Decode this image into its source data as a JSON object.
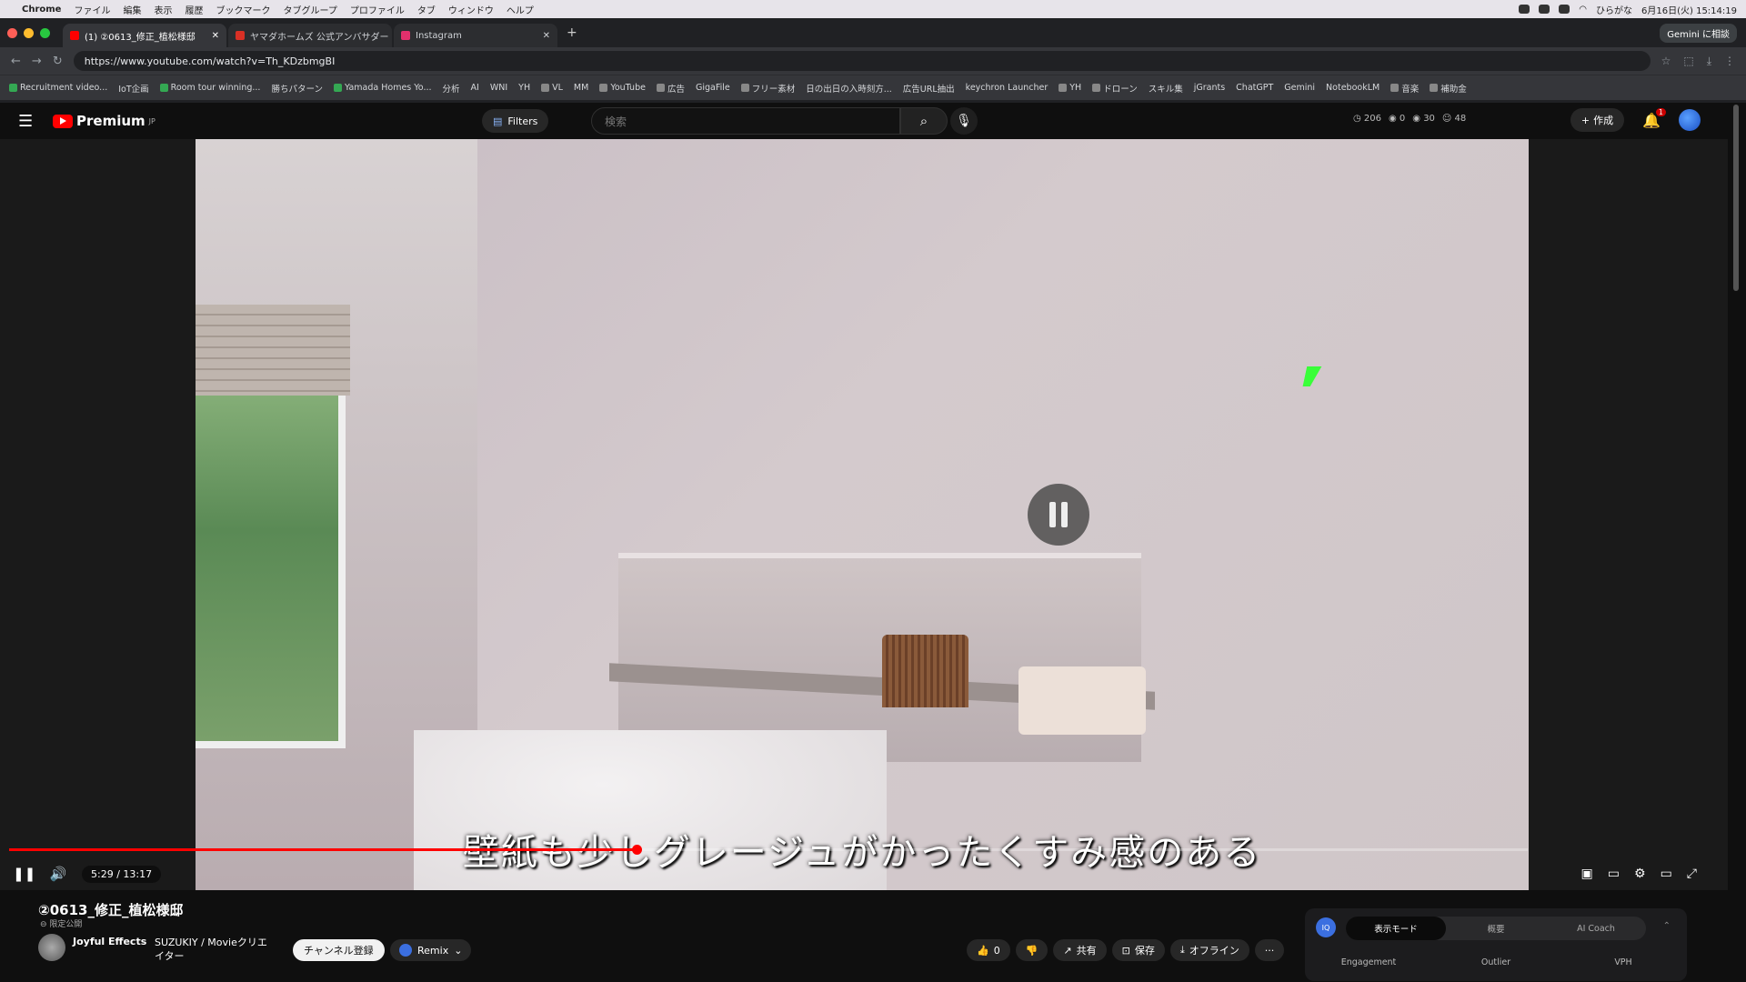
{
  "menubar": {
    "app": "Chrome",
    "items": [
      "ファイル",
      "編集",
      "表示",
      "履歴",
      "ブックマーク",
      "タブグループ",
      "プロファイル",
      "タブ",
      "ウィンドウ",
      "ヘルプ"
    ],
    "ime": "ひらがな",
    "datetime": "6月16日(火) 15:14:19"
  },
  "tabs": [
    {
      "title": "(1) ②0613_修正_植松様邸",
      "active": true,
      "color": "#ff0000"
    },
    {
      "title": "ヤマダホームズ 公式アンバサダー",
      "active": false,
      "color": "#d93025"
    },
    {
      "title": "Instagram",
      "active": false,
      "color": "#e1306c"
    }
  ],
  "gemini_btn": "Gemini に相談",
  "url": "https://www.youtube.com/watch?v=Th_KDzbmgBI",
  "bookmarks": [
    "Recruitment video...",
    "IoT企画",
    "Room tour winning...",
    "勝ちパターン",
    "Yamada Homes Yo...",
    "分析",
    "AI",
    "WNI",
    "YH",
    "VL",
    "MM",
    "YouTube",
    "広告",
    "GigaFile",
    "フリー素材",
    "日の出日の入時刻方...",
    "広告URL抽出",
    "keychron Launcher",
    "YH",
    "ドローン",
    "スキル集",
    "jGrants",
    "ChatGPT",
    "Gemini",
    "NotebookLM",
    "音楽",
    "補助金"
  ],
  "youtube": {
    "logo": "Premium",
    "logo_sup": "JP",
    "filters": "Filters",
    "search_placeholder": "検索",
    "stats": [
      "206",
      "0",
      "30",
      "48"
    ],
    "create": "作成",
    "notif_count": "1"
  },
  "player": {
    "subtitle": "壁紙も少しグレージュがかったくすみ感のある",
    "time": "5:29 / 13:17",
    "progress": 0.413
  },
  "video_info": {
    "title": "②0613_修正_植松様邸",
    "visibility": "限定公開",
    "channel": "Joyful Effects",
    "collab": "SUZUKIY / Movieクリエイター",
    "subscribe": "チャンネル登録",
    "remix": "Remix",
    "like_count": "0",
    "share": "共有",
    "save": "保存",
    "offline": "オフライン"
  },
  "panel": {
    "badge": "IQ",
    "tabs": [
      "表示モード",
      "概要",
      "AI Coach"
    ],
    "columns": [
      "Engagement",
      "Outlier",
      "VPH"
    ]
  }
}
